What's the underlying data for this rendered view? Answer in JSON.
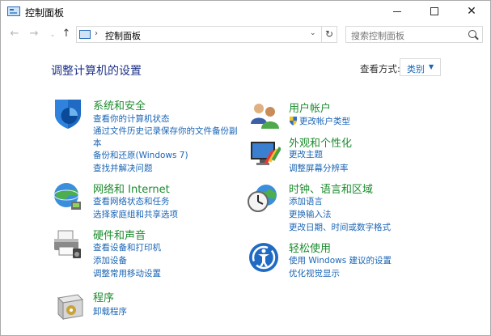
{
  "window": {
    "title": "控制面板",
    "address": "控制面板",
    "search_placeholder": "搜索控制面板",
    "close_glyph": "✕"
  },
  "main": {
    "heading": "调整计算机的设置",
    "view_by_label": "查看方式:",
    "view_by_value": "类别"
  },
  "categories": {
    "system": {
      "title": "系统和安全",
      "links": [
        "查看你的计算机状态",
        "通过文件历史记录保存你的文件备份副",
        "本",
        "备份和还原(Windows 7)",
        "查找并解决问题"
      ]
    },
    "network": {
      "title": "网络和 Internet",
      "links": [
        "查看网络状态和任务",
        "选择家庭组和共享选项"
      ]
    },
    "hardware": {
      "title": "硬件和声音",
      "links": [
        "查看设备和打印机",
        "添加设备",
        "调整常用移动设置"
      ]
    },
    "programs": {
      "title": "程序",
      "links": [
        "卸载程序"
      ]
    },
    "accounts": {
      "title": "用户帐户",
      "links": [
        "更改帐户类型"
      ]
    },
    "appearance": {
      "title": "外观和个性化",
      "links": [
        "更改主题",
        "调整屏幕分辨率"
      ]
    },
    "clock": {
      "title": "时钟、语言和区域",
      "links": [
        "添加语言",
        "更换输入法",
        "更改日期、时间或数字格式"
      ]
    },
    "ease": {
      "title": "轻松使用",
      "links": [
        "使用 Windows 建议的设置",
        "优化视觉显示"
      ]
    }
  },
  "colors": {
    "category_title": "#1c8c2e",
    "link": "#1a65b5",
    "heading": "#1e3287"
  }
}
